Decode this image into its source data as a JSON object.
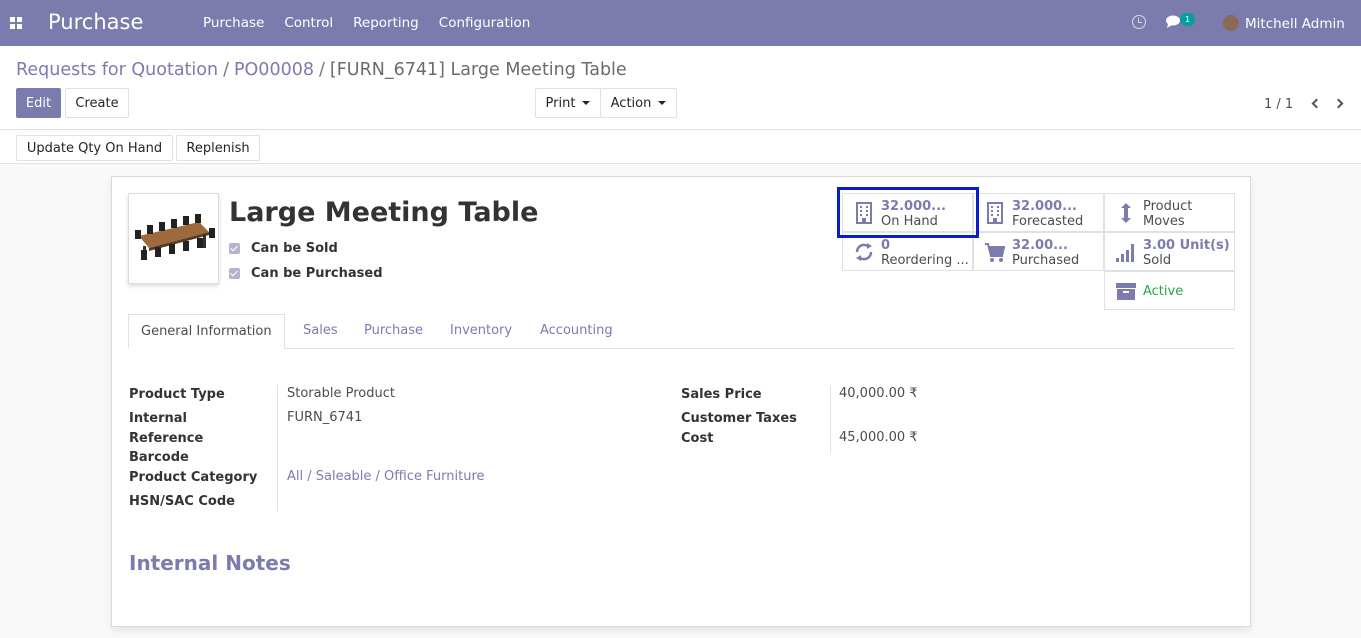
{
  "navbar": {
    "app_title": "Purchase",
    "menu": [
      "Purchase",
      "Control",
      "Reporting",
      "Configuration"
    ],
    "chat_badge": "1",
    "user_name": "Mitchell Admin"
  },
  "breadcrumb": {
    "items": [
      "Requests for Quotation",
      "PO00008"
    ],
    "current": "[FURN_6741] Large Meeting Table"
  },
  "toolbar": {
    "edit_label": "Edit",
    "create_label": "Create",
    "print_label": "Print",
    "action_label": "Action",
    "pager": "1 / 1"
  },
  "statusbar": {
    "update_qty_label": "Update Qty On Hand",
    "replenish_label": "Replenish"
  },
  "product": {
    "name": "Large Meeting Table",
    "can_be_sold_label": "Can be Sold",
    "can_be_purchased_label": "Can be Purchased"
  },
  "smart_buttons": {
    "on_hand": {
      "value": "32.000...",
      "label": "On Hand"
    },
    "forecasted": {
      "value": "32.000...",
      "label": "Forecasted"
    },
    "product_moves": {
      "line1": "Product",
      "line2": "Moves"
    },
    "reordering": {
      "value": "0",
      "label": "Reordering ..."
    },
    "purchased": {
      "value": "32.00...",
      "label": "Purchased"
    },
    "sold": {
      "value": "3.00 Unit(s)",
      "label": "Sold"
    },
    "active": {
      "label": "Active"
    }
  },
  "tabs": [
    "General Information",
    "Sales",
    "Purchase",
    "Inventory",
    "Accounting"
  ],
  "general": {
    "product_type_label": "Product Type",
    "product_type": "Storable Product",
    "internal_ref_label1": "Internal",
    "internal_ref_label2": "Reference",
    "internal_ref": "FURN_6741",
    "barcode_label": "Barcode",
    "category_label": "Product Category",
    "category": "All / Saleable / Office Furniture",
    "hsn_label": "HSN/SAC Code",
    "sales_price_label": "Sales Price",
    "sales_price": "40,000.00 ₹",
    "customer_taxes_label": "Customer Taxes",
    "cost_label": "Cost",
    "cost": "45,000.00 ₹"
  },
  "notes": {
    "title": "Internal Notes"
  },
  "colors": {
    "brand": "#7c7bad",
    "active_green": "#28a745",
    "highlight": "#0a1ccc"
  }
}
